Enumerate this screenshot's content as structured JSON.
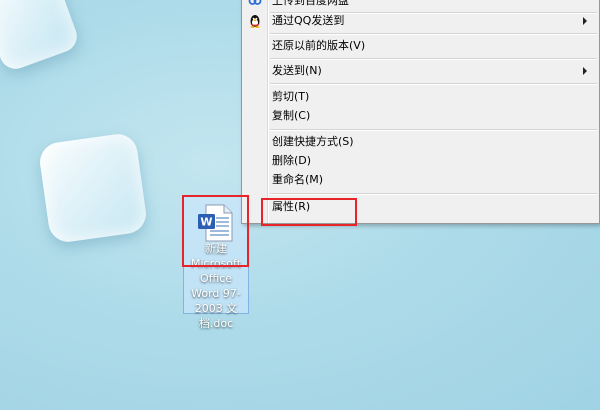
{
  "desktop": {
    "file": {
      "label": "新建 Microsoft Office Word 97-2003 文档.doc",
      "icon": "word-document-icon"
    }
  },
  "context_menu": {
    "items": [
      {
        "label": "上传到百度网盘",
        "icon": "baidu-netdisk-icon",
        "submenu": false
      },
      {
        "label": "通过QQ发送到",
        "icon": "qq-penguin-icon",
        "submenu": true
      },
      {
        "label": "还原以前的版本(V)",
        "submenu": false
      },
      {
        "label": "发送到(N)",
        "submenu": true
      },
      {
        "label": "剪切(T)",
        "submenu": false
      },
      {
        "label": "复制(C)",
        "submenu": false
      },
      {
        "label": "创建快捷方式(S)",
        "submenu": false
      },
      {
        "label": "删除(D)",
        "submenu": false
      },
      {
        "label": "重命名(M)",
        "submenu": false
      },
      {
        "label": "属性(R)",
        "submenu": false
      }
    ]
  },
  "annotation_color": "#e8242b"
}
